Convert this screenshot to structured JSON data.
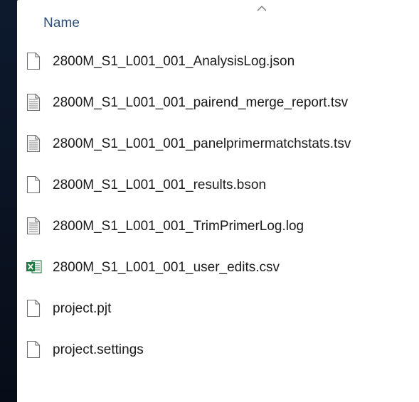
{
  "column_header": {
    "label": "Name",
    "sort_indicator": "caret-up-icon"
  },
  "files": [
    {
      "name": "2800M_S1_L001_001_AnalysisLog.json",
      "icon": "blank-document-icon"
    },
    {
      "name": "2800M_S1_L001_001_pairend_merge_report.tsv",
      "icon": "text-document-icon"
    },
    {
      "name": "2800M_S1_L001_001_panelprimermatchstats.tsv",
      "icon": "text-document-icon"
    },
    {
      "name": "2800M_S1_L001_001_results.bson",
      "icon": "blank-document-icon"
    },
    {
      "name": "2800M_S1_L001_001_TrimPrimerLog.log",
      "icon": "text-document-icon"
    },
    {
      "name": "2800M_S1_L001_001_user_edits.csv",
      "icon": "excel-csv-icon"
    },
    {
      "name": "project.pjt",
      "icon": "blank-document-icon"
    },
    {
      "name": "project.settings",
      "icon": "blank-document-icon"
    }
  ],
  "colors": {
    "header_text": "#2b4f7a",
    "excel_green": "#1f7a44",
    "background": "#0b1424"
  }
}
